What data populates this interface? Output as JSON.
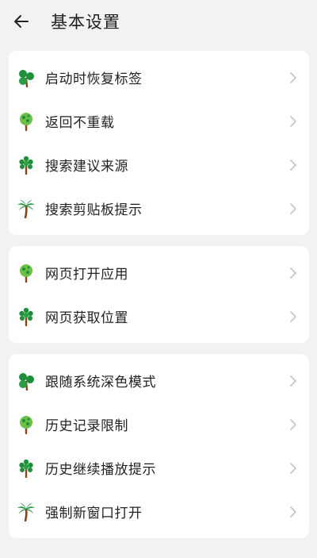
{
  "header": {
    "title": "基本设置"
  },
  "sections": [
    {
      "items": [
        {
          "label": "启动时恢复标签",
          "icon": "clover-tree-icon"
        },
        {
          "label": "返回不重载",
          "icon": "round-tree-icon"
        },
        {
          "label": "搜索建议来源",
          "icon": "bushy-tree-icon"
        },
        {
          "label": "搜索剪贴板提示",
          "icon": "palm-tree-icon"
        }
      ]
    },
    {
      "items": [
        {
          "label": "网页打开应用",
          "icon": "round-tree-icon"
        },
        {
          "label": "网页获取位置",
          "icon": "bushy-tree-icon"
        }
      ]
    },
    {
      "items": [
        {
          "label": "跟随系统深色模式",
          "icon": "clover-tree-icon"
        },
        {
          "label": "历史记录限制",
          "icon": "round-tree-icon"
        },
        {
          "label": "历史继续播放提示",
          "icon": "bushy-tree-icon"
        },
        {
          "label": "强制新窗口打开",
          "icon": "palm-tree-icon"
        }
      ]
    }
  ],
  "colors": {
    "background": "#f2f2f2",
    "card": "#ffffff",
    "leaf_dark": "#1f8f3a",
    "leaf_light": "#6cc04a",
    "trunk": "#7a4a22",
    "chevron": "#c4c4c4"
  }
}
